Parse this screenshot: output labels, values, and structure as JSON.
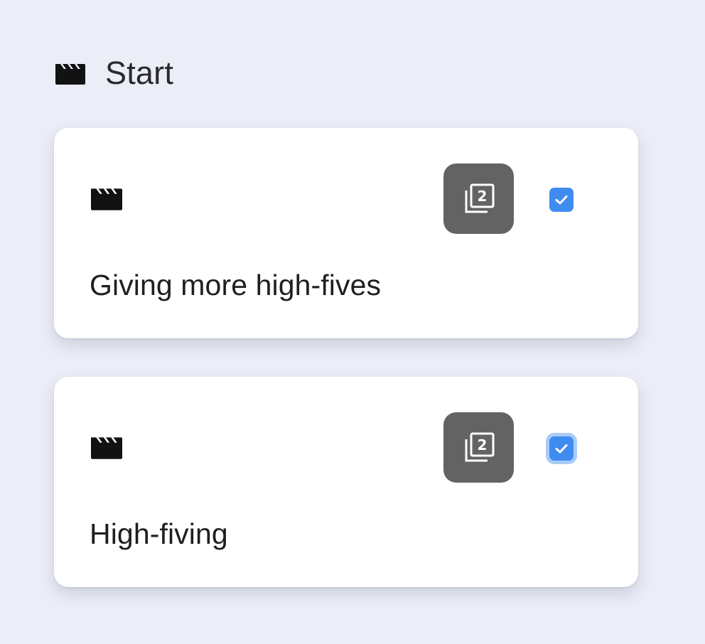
{
  "section": {
    "title": "Start",
    "icon": "clapperboard-icon"
  },
  "cards": [
    {
      "label": "Giving more high-fives",
      "icon": "clapperboard-icon",
      "stack_icon": "filter-2-icon",
      "stack_number": "2",
      "checked": true
    },
    {
      "label": "High-fiving",
      "icon": "clapperboard-icon",
      "stack_icon": "filter-2-icon",
      "stack_number": "2",
      "checked": true
    }
  ],
  "colors": {
    "background": "#ebedf7",
    "card": "#ffffff",
    "stack_button": "#636363",
    "checkbox": "#3f8cf0",
    "checkbox_focus_ring": "#a9cbf8"
  }
}
